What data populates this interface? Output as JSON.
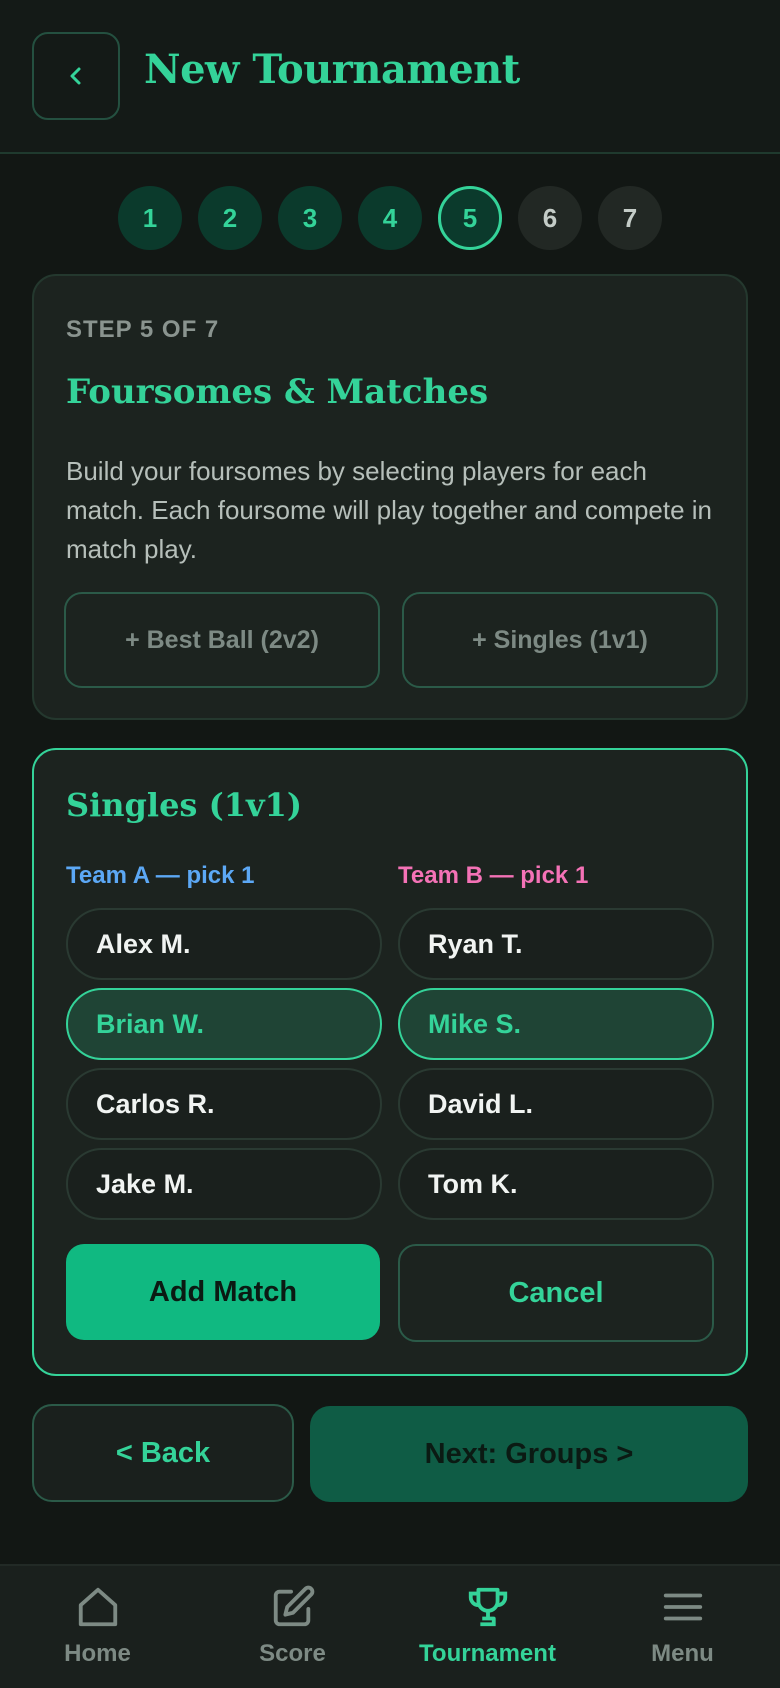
{
  "header": {
    "title": "New Tournament",
    "back_icon": "chevron-left-icon"
  },
  "stepper": {
    "current": 5,
    "steps": [
      "1",
      "2",
      "3",
      "4",
      "5",
      "6",
      "7"
    ]
  },
  "intro": {
    "eyebrow": "STEP 5 OF 7",
    "title": "Foursomes & Matches",
    "description": "Build your foursomes by selecting players for each match. Each foursome will play together and compete in match play.",
    "add_best_ball": "+ Best Ball (2v2)",
    "add_singles": "+ Singles (1v1)"
  },
  "match": {
    "title": "Singles (1v1)",
    "team_a_label": "Team A — pick 1",
    "team_b_label": "Team B — pick 1",
    "team_a": [
      {
        "name": "Alex M.",
        "selected": false
      },
      {
        "name": "Brian W.",
        "selected": true
      },
      {
        "name": "Carlos R.",
        "selected": false
      },
      {
        "name": "Jake M.",
        "selected": false
      }
    ],
    "team_b": [
      {
        "name": "Ryan T.",
        "selected": false
      },
      {
        "name": "Mike S.",
        "selected": true
      },
      {
        "name": "David L.",
        "selected": false
      },
      {
        "name": "Tom K.",
        "selected": false
      }
    ],
    "add_label": "Add Match",
    "cancel_label": "Cancel"
  },
  "footer_nav": {
    "back_label": "< Back",
    "next_label": "Next: Groups >"
  },
  "tabbar": {
    "active": "Tournament",
    "tabs": [
      {
        "label": "Home",
        "icon": "home-icon"
      },
      {
        "label": "Score",
        "icon": "edit-icon"
      },
      {
        "label": "Tournament",
        "icon": "trophy-icon"
      },
      {
        "label": "Menu",
        "icon": "menu-icon"
      }
    ]
  },
  "colors": {
    "accent": "#34d399",
    "primary": "#10b981",
    "team_a": "#5ca8f5",
    "team_b": "#f472b6",
    "background": "#121714"
  }
}
